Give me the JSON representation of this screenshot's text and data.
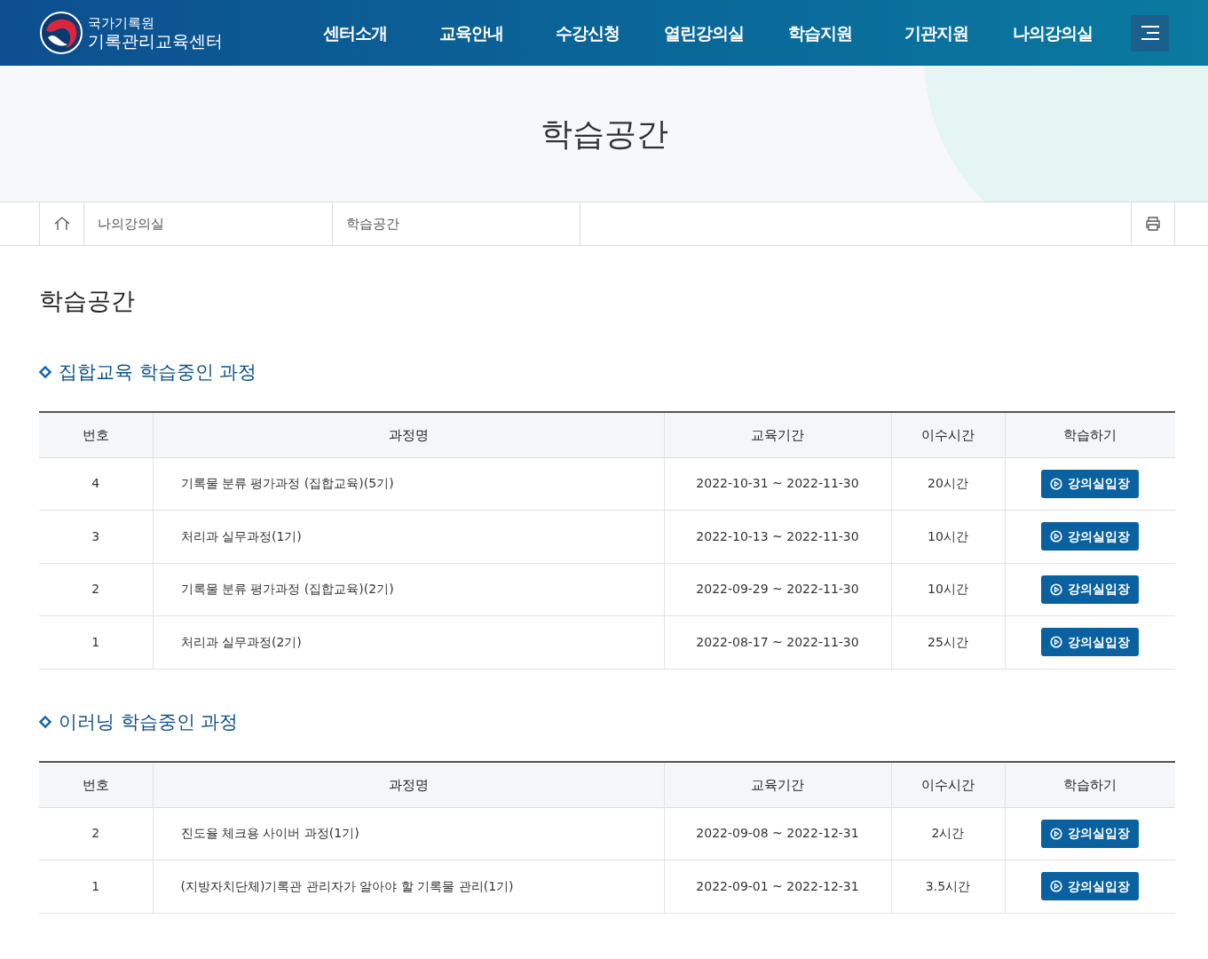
{
  "header": {
    "logo_top": "국가기록원",
    "logo_bottom": "기록관리교육센터",
    "nav": [
      "센터소개",
      "교육안내",
      "수강신청",
      "열린강의실",
      "학습지원",
      "기관지원",
      "나의강의실"
    ]
  },
  "hero": {
    "title": "학습공간"
  },
  "breadcrumb": [
    "나의강의실",
    "학습공간"
  ],
  "page_title": "학습공간",
  "sections": [
    {
      "title": "집합교육 학습중인 과정",
      "columns": [
        "번호",
        "과정명",
        "교육기간",
        "이수시간",
        "학습하기"
      ],
      "rows": [
        {
          "no": "4",
          "course": "기록물 분류 평가과정 (집합교육)(5기)",
          "period": "2022-10-31 ~ 2022-11-30",
          "hours": "20시간",
          "action": "강의실입장"
        },
        {
          "no": "3",
          "course": "처리과 실무과정(1기)",
          "period": "2022-10-13 ~ 2022-11-30",
          "hours": "10시간",
          "action": "강의실입장"
        },
        {
          "no": "2",
          "course": "기록물 분류 평가과정 (집합교육)(2기)",
          "period": "2022-09-29 ~ 2022-11-30",
          "hours": "10시간",
          "action": "강의실입장"
        },
        {
          "no": "1",
          "course": "처리과 실무과정(2기)",
          "period": "2022-08-17 ~ 2022-11-30",
          "hours": "25시간",
          "action": "강의실입장"
        }
      ]
    },
    {
      "title": "이러닝 학습중인 과정",
      "columns": [
        "번호",
        "과정명",
        "교육기간",
        "이수시간",
        "학습하기"
      ],
      "rows": [
        {
          "no": "2",
          "course": "진도율 체크용 사이버 과정(1기)",
          "period": "2022-09-08 ~ 2022-12-31",
          "hours": "2시간",
          "action": "강의실입장"
        },
        {
          "no": "1",
          "course": "(지방자치단체)기록관 관리자가 알아야 할 기록물 관리(1기)",
          "period": "2022-09-01 ~ 2022-12-31",
          "hours": "3.5시간",
          "action": "강의실입장"
        }
      ]
    }
  ]
}
